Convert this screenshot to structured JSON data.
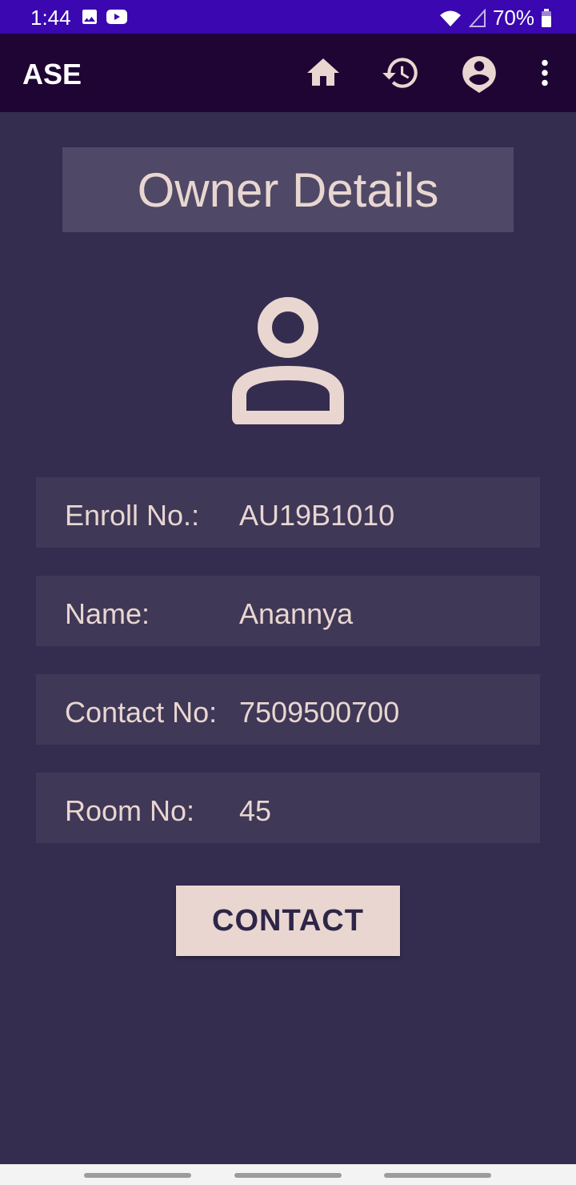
{
  "status_bar": {
    "time": "1:44",
    "battery": "70%",
    "icons": [
      "image-icon",
      "youtube-icon",
      "wifi-icon",
      "signal-icon",
      "battery-icon"
    ]
  },
  "app_bar": {
    "title": "ASE",
    "actions": [
      "home-icon",
      "history-icon",
      "account-icon",
      "more-vert-icon"
    ]
  },
  "page": {
    "title": "Owner Details"
  },
  "details": {
    "enroll_label": "Enroll No.:",
    "enroll_value": "AU19B1010",
    "name_label": "Name:",
    "name_value": "Anannya",
    "contact_label": "Contact No:",
    "contact_value": "7509500700",
    "room_label": "Room No:",
    "room_value": "45"
  },
  "actions": {
    "contact_label": "CONTACT"
  },
  "colors": {
    "status_bar": "#3a07b0",
    "app_bar": "#1e0533",
    "background": "#352d4f",
    "row_bg": "#3f3857",
    "header_bg": "#4f4866",
    "text": "#e9d6d0"
  }
}
